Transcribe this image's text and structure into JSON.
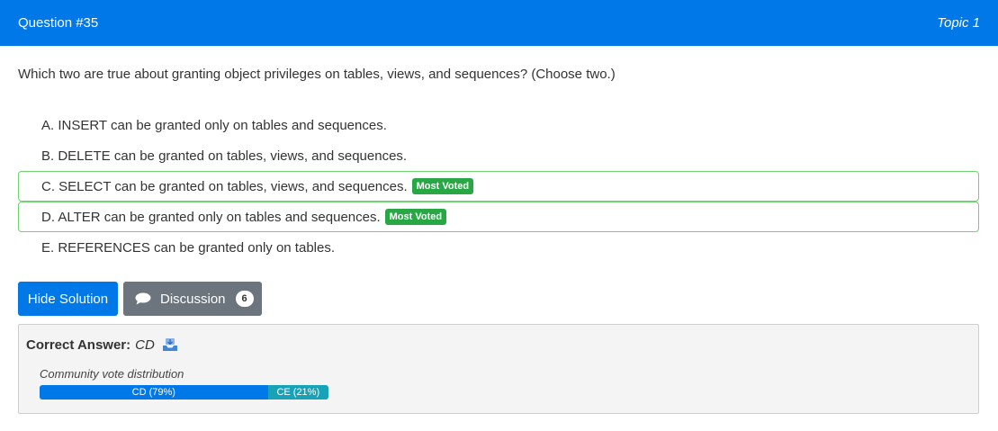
{
  "header": {
    "question_number": "Question #35",
    "topic": "Topic 1"
  },
  "question": {
    "text": "Which two are true about granting object privileges on tables, views, and sequences? (Choose two.)"
  },
  "choices": [
    {
      "text": "A. INSERT can be granted only on tables and sequences.",
      "most_voted": false
    },
    {
      "text": "B. DELETE can be granted on tables, views, and sequences.",
      "most_voted": false
    },
    {
      "text": "C. SELECT can be granted on tables, views, and sequences.",
      "most_voted": true,
      "badge": "Most Voted"
    },
    {
      "text": "D. ALTER can be granted only on tables and sequences.",
      "most_voted": true,
      "badge": "Most Voted"
    },
    {
      "text": "E. REFERENCES can be granted only on tables.",
      "most_voted": false
    }
  ],
  "buttons": {
    "hide_solution": "Hide Solution",
    "discussion": "Discussion",
    "discussion_count": "6"
  },
  "icons": {
    "discussion": "speech-bubble-icon",
    "answer": "inbox-tray-icon"
  },
  "answer": {
    "label": "Correct Answer:",
    "value": "CD"
  },
  "votes": {
    "label": "Community vote distribution",
    "segments": [
      {
        "text": "CD (79%)",
        "percent": 79,
        "color": "#0078e7"
      },
      {
        "text": "CE (21%)",
        "percent": 21,
        "color": "#17a2b8"
      }
    ]
  },
  "colors": {
    "primary": "#0078e7",
    "success": "#28a745",
    "secondary": "#6c757d"
  }
}
